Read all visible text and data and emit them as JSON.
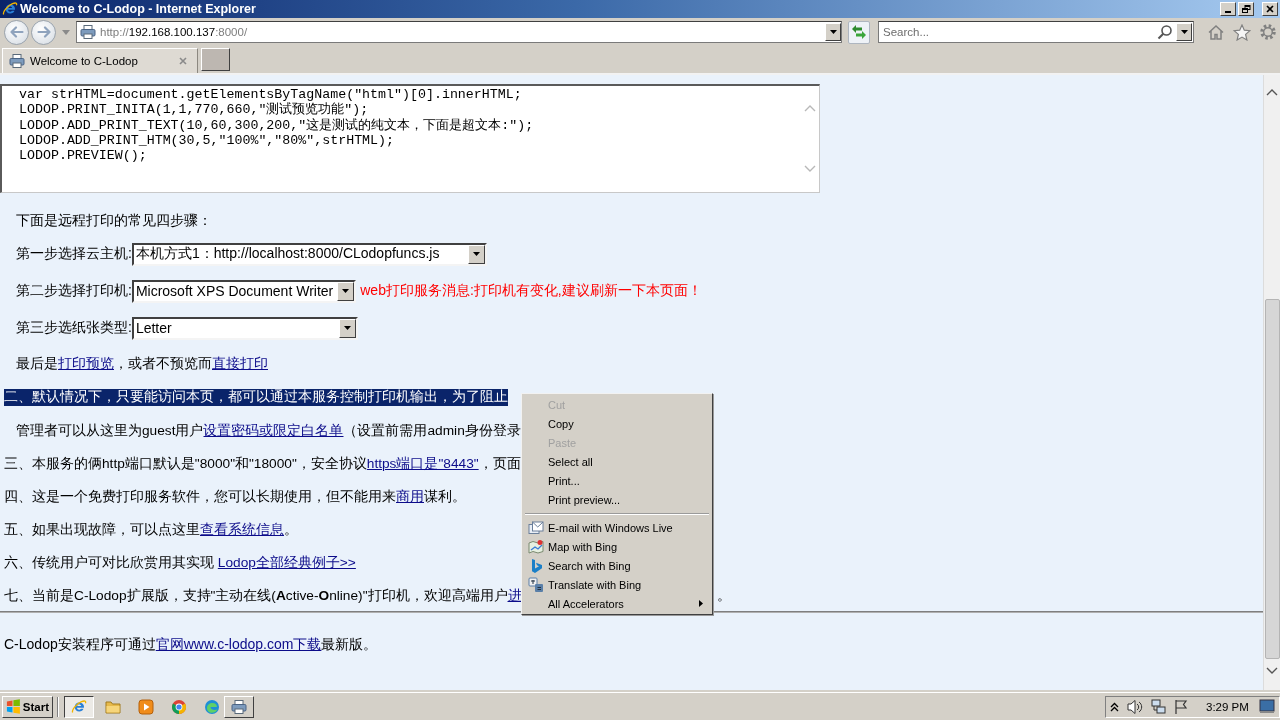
{
  "window": {
    "title": "Welcome to C-Lodop - Internet Explorer"
  },
  "address_bar": {
    "url": [
      {
        "text": "http://",
        "kind": "dim"
      },
      {
        "text": "192.168.100.137",
        "kind": "host"
      },
      {
        "text": ":8000/",
        "kind": "dim"
      }
    ]
  },
  "search": {
    "placeholder": "Search..."
  },
  "tabs": [
    {
      "label": "Welcome to C-Lodop",
      "selected": true
    }
  ],
  "page": {
    "code": [
      "var strHTML=document.getElementsByTagName(\"html\")[0].innerHTML;",
      "LODOP.PRINT_INITA(1,1,770,660,\"测试预览功能\");",
      "LODOP.ADD_PRINT_TEXT(10,60,300,200,\"这是测试的纯文本，下面是超文本:\");",
      "LODOP.ADD_PRINT_HTM(30,5,\"100%\",\"80%\",strHTML);",
      "LODOP.PREVIEW();"
    ],
    "intro": "下面是远程打印的常见四步骤：",
    "steps": [
      {
        "label": "第一步选择云主机:",
        "value": "本机方式1：http://localhost:8000/CLodopfuncs.js"
      },
      {
        "label": "第二步选择打印机:",
        "value": "Microsoft XPS Document Writer",
        "message": "web打印服务消息:打印机有变化,建议刷新一下本页面！"
      },
      {
        "label": "第三步选纸张类型:",
        "value": "Letter"
      }
    ],
    "paragraphs": [
      {
        "kind": "note",
        "selected": false,
        "segments": [
          {
            "kind": "text",
            "text": "最后是"
          },
          {
            "kind": "link",
            "text": "打印预览"
          },
          {
            "kind": "text",
            "text": "，或者不预览而"
          },
          {
            "kind": "link",
            "text": "直接打印"
          }
        ]
      },
      {
        "kind": "item",
        "selected": true,
        "segments": [
          {
            "kind": "text",
            "text": "二、默认情况下，只要能访问本页，都可以通过本服务控制打印机输出，为了阻止"
          }
        ]
      },
      {
        "kind": "note",
        "selected": false,
        "segments": [
          {
            "kind": "text",
            "text": "管理者可以从这里为guest用户"
          },
          {
            "kind": "link",
            "text": "设置密码或限定白名单"
          },
          {
            "kind": "text",
            "text": "（设置前需用admin身份登录"
          }
        ]
      },
      {
        "kind": "item",
        "selected": false,
        "segments": [
          {
            "kind": "text",
            "text": "三、本服务的俩http端口默认是\"8000\"和\"18000\"，安全协议"
          },
          {
            "kind": "link",
            "text": "https端口是\"8443\""
          },
          {
            "kind": "text",
            "text": "，页面"
          }
        ]
      },
      {
        "kind": "item",
        "selected": false,
        "segments": [
          {
            "kind": "text",
            "text": "四、这是一个免费打印服务软件，您可以长期使用，但不能用来"
          },
          {
            "kind": "link",
            "text": "商用"
          },
          {
            "kind": "text",
            "text": "谋利。"
          }
        ]
      },
      {
        "kind": "item",
        "selected": false,
        "segments": [
          {
            "kind": "text",
            "text": "五、如果出现故障，可以点这里"
          },
          {
            "kind": "link",
            "text": "查看系统信息"
          },
          {
            "kind": "text",
            "text": "。"
          }
        ]
      },
      {
        "kind": "item",
        "selected": false,
        "segments": [
          {
            "kind": "text",
            "text": "六、传统用户可对比欣赏用其实现 "
          },
          {
            "kind": "link",
            "text": "Lodop全部经典例子>>"
          }
        ]
      },
      {
        "kind": "item",
        "selected": false,
        "segments": [
          {
            "kind": "text",
            "text": "七、当前是C-Lodop扩展版，支持\"主动在线(**A**ctive-**O**nline)\"打印机，欢迎高端用户"
          },
          {
            "kind": "link",
            "text": "进"
          },
          {
            "kind": "tail",
            "text": "。"
          }
        ]
      }
    ],
    "footer": {
      "segments": [
        {
          "kind": "text",
          "text": "C-Lodop安装程序可通过"
        },
        {
          "kind": "link",
          "text": "官网www.c-lodop.com下载"
        },
        {
          "kind": "text",
          "text": "最新版。"
        }
      ]
    }
  },
  "context_menu": {
    "items": [
      {
        "kind": "command",
        "label": "Cut",
        "disabled": true
      },
      {
        "kind": "command",
        "label": "Copy",
        "disabled": false
      },
      {
        "kind": "command",
        "label": "Paste",
        "disabled": true
      },
      {
        "kind": "command",
        "label": "Select all",
        "disabled": false
      },
      {
        "kind": "command",
        "label": "Print...",
        "disabled": false
      },
      {
        "kind": "command",
        "label": "Print preview...",
        "disabled": false
      },
      {
        "kind": "separator"
      },
      {
        "kind": "accelerator",
        "label": "E-mail with Windows Live",
        "disabled": false
      },
      {
        "kind": "accelerator",
        "label": "Map with Bing",
        "disabled": false
      },
      {
        "kind": "accelerator",
        "label": "Search with Bing",
        "disabled": false
      },
      {
        "kind": "accelerator",
        "label": "Translate with Bing",
        "disabled": false
      },
      {
        "kind": "submenu",
        "label": "All Accelerators",
        "disabled": false
      }
    ]
  },
  "taskbar": {
    "start": "Start",
    "buttons": [
      {
        "kind": "window",
        "selected": true
      },
      {
        "kind": "launcher",
        "selected": false
      },
      {
        "kind": "launcher",
        "selected": false
      },
      {
        "kind": "launcher",
        "selected": false
      },
      {
        "kind": "launcher",
        "selected": false
      },
      {
        "kind": "window",
        "selected": false
      }
    ],
    "clock": "3:29 PM"
  }
}
